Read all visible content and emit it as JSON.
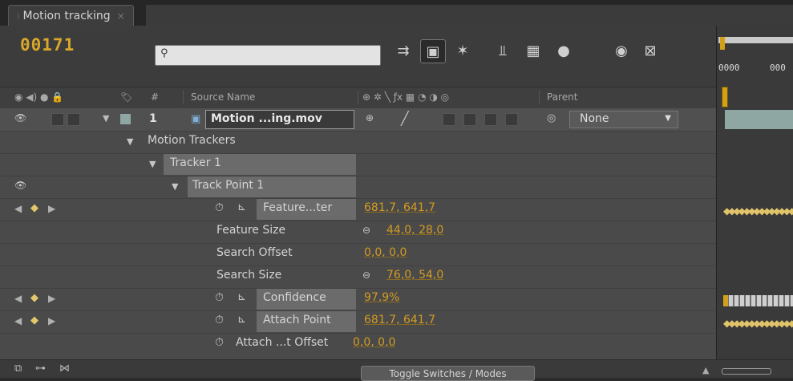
{
  "panel": {
    "tab_title": "Motion tracking",
    "tab_close": "×"
  },
  "toolbar": {
    "timecode": "00171",
    "search_placeholder": ""
  },
  "columns": {
    "source_name": "Source Name",
    "hash": "#",
    "parent": "Parent"
  },
  "timeline": {
    "tick1": "0000",
    "tick2": "000"
  },
  "layer": {
    "number": "1",
    "name": "Motion ...ing.mov",
    "parent_value": "None"
  },
  "rows": {
    "motion_trackers": "Motion Trackers",
    "tracker1": "Tracker 1",
    "track_point1": "Track Point 1",
    "feature_center": {
      "label": "Feature...ter",
      "value": "681,7, 641,7"
    },
    "feature_size": {
      "label": "Feature Size",
      "value": "44,0, 28,0"
    },
    "search_offset": {
      "label": "Search Offset",
      "value": "0,0, 0,0"
    },
    "search_size": {
      "label": "Search Size",
      "value": "76,0, 54,0"
    },
    "confidence": {
      "label": "Confidence",
      "value": "97,9%"
    },
    "attach_point": {
      "label": "Attach Point",
      "value": "681,7, 641,7"
    },
    "attach_offset": {
      "label": "Attach ...t Offset",
      "value": "0,0, 0,0"
    }
  },
  "bottom": {
    "toggle_label": "Toggle Switches / Modes"
  },
  "colors": {
    "accent": "#d39b21",
    "bg": "#4a4a4a",
    "layer_color": "#8fa7a3"
  }
}
